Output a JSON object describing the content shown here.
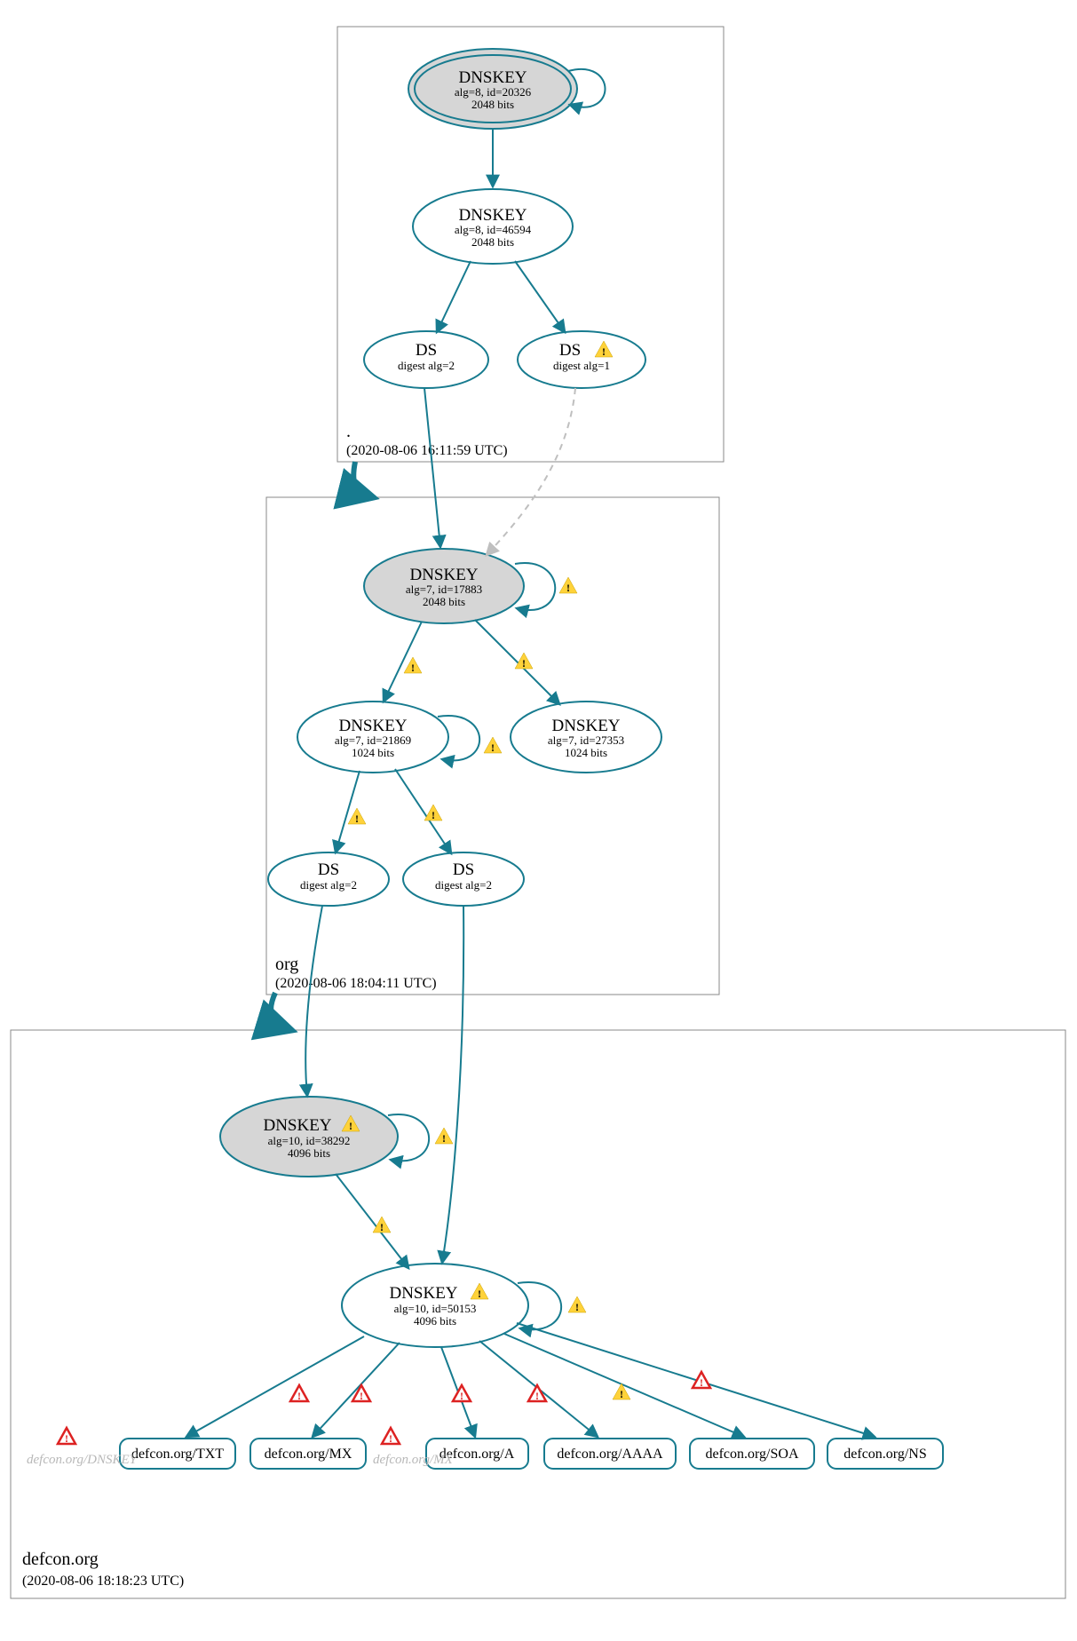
{
  "zones": {
    "root": {
      "name": ".",
      "time": "(2020-08-06 16:11:59 UTC)"
    },
    "org": {
      "name": "org",
      "time": "(2020-08-06 18:04:11 UTC)"
    },
    "defcon": {
      "name": "defcon.org",
      "time": "(2020-08-06 18:18:23 UTC)"
    }
  },
  "nodes": {
    "root_ksk": {
      "title": "DNSKEY",
      "sub1": "alg=8, id=20326",
      "sub2": "2048 bits"
    },
    "root_zsk": {
      "title": "DNSKEY",
      "sub1": "alg=8, id=46594",
      "sub2": "2048 bits"
    },
    "root_ds1": {
      "title": "DS",
      "sub1": "digest alg=2"
    },
    "root_ds2": {
      "title": "DS",
      "sub1": "digest alg=1"
    },
    "org_ksk": {
      "title": "DNSKEY",
      "sub1": "alg=7, id=17883",
      "sub2": "2048 bits"
    },
    "org_zsk1": {
      "title": "DNSKEY",
      "sub1": "alg=7, id=21869",
      "sub2": "1024 bits"
    },
    "org_zsk2": {
      "title": "DNSKEY",
      "sub1": "alg=7, id=27353",
      "sub2": "1024 bits"
    },
    "org_ds1": {
      "title": "DS",
      "sub1": "digest alg=2"
    },
    "org_ds2": {
      "title": "DS",
      "sub1": "digest alg=2"
    },
    "dc_ksk": {
      "title": "DNSKEY",
      "sub1": "alg=10, id=38292",
      "sub2": "4096 bits"
    },
    "dc_zsk": {
      "title": "DNSKEY",
      "sub1": "alg=10, id=50153",
      "sub2": "4096 bits"
    }
  },
  "rr": {
    "txt": "defcon.org/TXT",
    "mx": "defcon.org/MX",
    "a": "defcon.org/A",
    "aaaa": "defcon.org/AAAA",
    "soa": "defcon.org/SOA",
    "ns": "defcon.org/NS"
  },
  "faded": {
    "dnskey": "defcon.org/DNSKEY",
    "mx": "defcon.org/MX"
  }
}
